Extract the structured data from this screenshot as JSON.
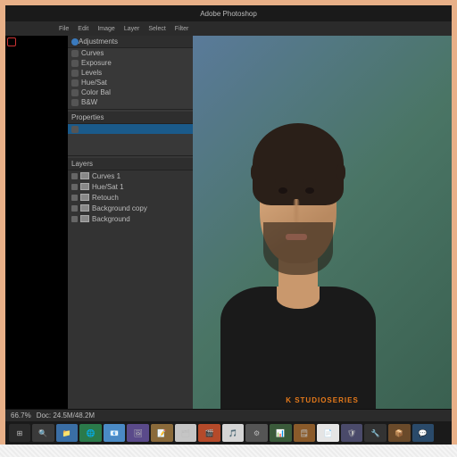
{
  "title": "Adobe Photoshop",
  "menu": [
    "File",
    "Edit",
    "Image",
    "Layer",
    "Select",
    "Filter"
  ],
  "panels": {
    "adjustments_label": "Adjustments",
    "properties_label": "Properties",
    "items": [
      {
        "label": "Curves"
      },
      {
        "label": "Exposure"
      },
      {
        "label": "Levels"
      },
      {
        "label": "Hue/Sat"
      },
      {
        "label": "Color Bal"
      },
      {
        "label": "B&W"
      }
    ],
    "layers_label": "Layers",
    "layers": [
      {
        "name": "Curves 1"
      },
      {
        "name": "Hue/Sat 1"
      },
      {
        "name": "Retouch"
      },
      {
        "name": "Background copy"
      },
      {
        "name": "Background"
      }
    ]
  },
  "watermark": {
    "part1": "K ",
    "part2": "STUDIOSERIES"
  },
  "status": {
    "zoom": "66.7%",
    "doc": "Doc: 24.5M/48.2M"
  },
  "taskbar_apps": [
    "⊞",
    "🔍",
    "📁",
    "🌐",
    "📧",
    "🖼",
    "📝",
    "🗂",
    "🎬",
    "🎵",
    "⚙",
    "📊",
    "🗒",
    "📄",
    "🛡",
    "🔧",
    "📦",
    "💬"
  ],
  "colors": {
    "accent": "#e67a1a",
    "select": "#1a5a8a"
  }
}
